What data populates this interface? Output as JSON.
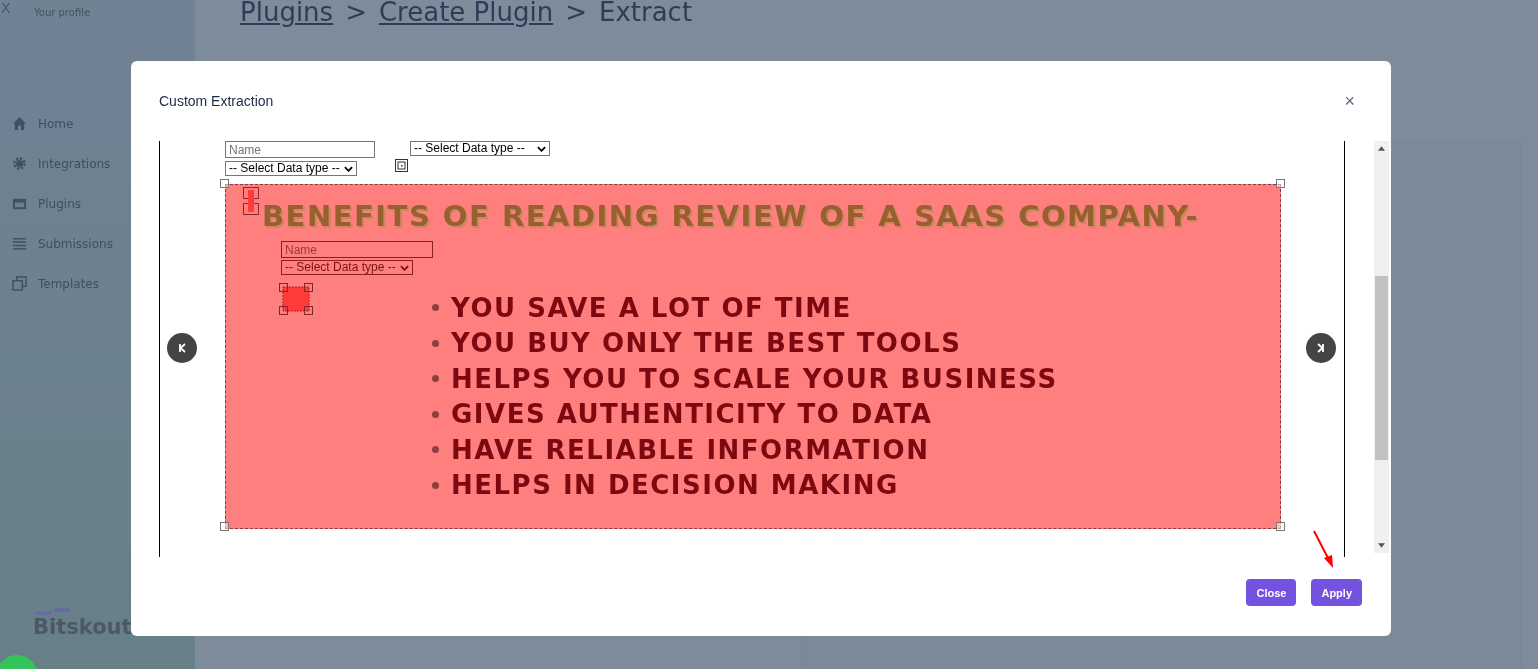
{
  "sidebar": {
    "close": "X",
    "profile": "Your profile",
    "items": [
      {
        "label": "Home"
      },
      {
        "label": "Integrations"
      },
      {
        "label": "Plugins"
      },
      {
        "label": "Submissions"
      },
      {
        "label": "Templates"
      }
    ],
    "logo": "Bitskout"
  },
  "breadcrumb": [
    {
      "kind": "link",
      "text": "Plugins"
    },
    {
      "kind": "separator",
      "text": ">"
    },
    {
      "kind": "link",
      "text": "Create Plugin"
    },
    {
      "kind": "separator",
      "text": ">"
    },
    {
      "kind": "current",
      "text": "Extract"
    }
  ],
  "modal": {
    "title": "Custom Extraction",
    "close": "×",
    "document": {
      "heading": "BENEFITS OF READING REVIEW OF A SAAS COMPANY-",
      "bullets": [
        "YOU SAVE A LOT OF TIME",
        "YOU BUY ONLY THE BEST TOOLS",
        "HELPS YOU TO SCALE YOUR BUSINESS",
        "GIVES AUTHENTICITY TO DATA",
        "HAVE RELIABLE INFORMATION",
        "HELPS IN DECISION MAKING"
      ]
    },
    "annotations": [
      {
        "kind": "name",
        "placeholder": "Name",
        "selected": false
      },
      {
        "kind": "select",
        "value": "-- Select Data type --",
        "selected": false
      },
      {
        "kind": "select",
        "value": "-- Select Data type --",
        "selected": false
      },
      {
        "kind": "name",
        "placeholder": "Name",
        "selected": true
      },
      {
        "kind": "select",
        "value": "-- Select Data type --",
        "selected": true
      }
    ],
    "buttons": [
      {
        "label": "Close"
      },
      {
        "label": "Apply"
      }
    ]
  }
}
